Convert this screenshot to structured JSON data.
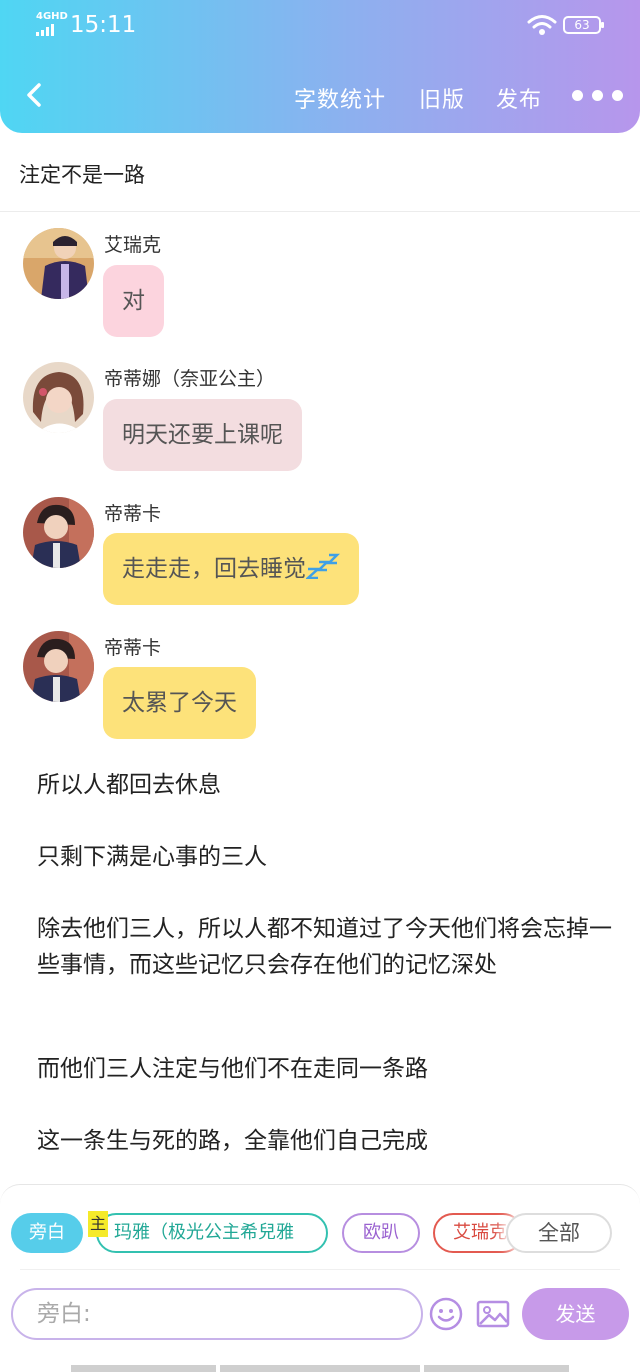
{
  "status_bar": {
    "network": "4GHD",
    "time": "15:11",
    "battery": "63"
  },
  "nav": {
    "word_count": "字数统计",
    "old_version": "旧版",
    "publish": "发布"
  },
  "title": "注定不是一路",
  "messages": [
    {
      "sender": "艾瑞克",
      "text": "对",
      "color": "#fcd4de"
    },
    {
      "sender": "帝蒂娜（奈亚公主）",
      "text": "明天还要上课呢",
      "color": "#f3dde0"
    },
    {
      "sender": "帝蒂卡",
      "text": "走走走，回去睡觉",
      "color": "#fde27a"
    },
    {
      "sender": "帝蒂卡",
      "text": "太累了今天",
      "color": "#fde27a"
    }
  ],
  "narration": [
    "所以人都回去休息",
    "只剩下满是心事的三人",
    "除去他们三人，所以人都不知道过了今天他们将会忘掉一些事情，而这些记忆只会存在他们的记忆深处",
    "而他们三人注定与他们不在走同一条路",
    "这一条生与死的路，全靠他们自己完成"
  ],
  "role_chips": {
    "narrator": "旁白",
    "main_tag": "主",
    "char1": "玛雅（极光公主希兒雅",
    "char2": "欧趴",
    "char3": "艾瑞克",
    "all": "全部"
  },
  "input": {
    "placeholder": "旁白:"
  },
  "send_label": "发送",
  "accent": "#c79ae9"
}
